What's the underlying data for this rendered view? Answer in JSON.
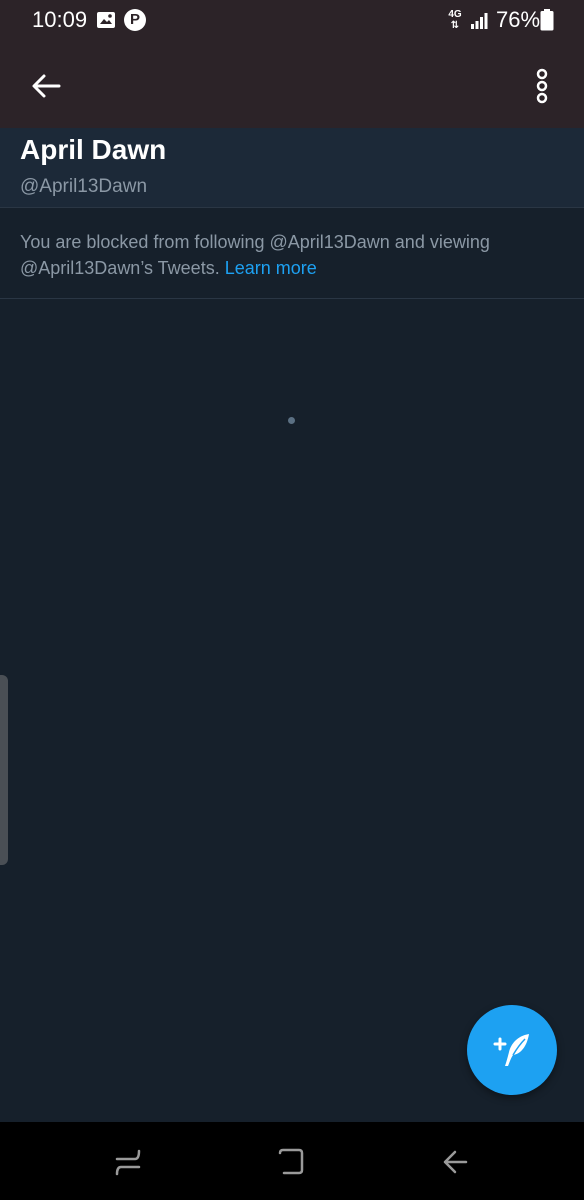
{
  "status_bar": {
    "time": "10:09",
    "network": "4G",
    "battery": "76%",
    "icons": [
      "gallery-icon",
      "p-app-icon",
      "signal-icon",
      "battery-icon"
    ]
  },
  "app_bar": {
    "back_icon": "arrow-left-icon",
    "menu_icon": "more-vertical-icon"
  },
  "profile": {
    "name": "April Dawn",
    "handle": "@April13Dawn"
  },
  "blocked": {
    "message": "You are blocked from following @April13Dawn and viewing @April13Dawn’s Tweets.",
    "link_text": "Learn more"
  },
  "fab": {
    "icon": "compose-tweet-icon"
  },
  "nav_bar": {
    "icons": [
      "recent-apps-icon",
      "home-icon",
      "back-nav-icon"
    ]
  },
  "colors": {
    "background": "#16202b",
    "app_bar": "#2c2328",
    "header": "#1c2938",
    "accent": "#1da1f2",
    "secondary_text": "#8b98a5"
  }
}
